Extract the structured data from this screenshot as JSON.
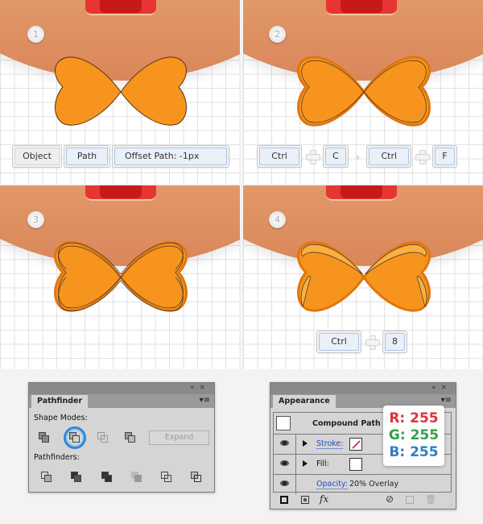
{
  "steps": [
    {
      "number": "1",
      "keys": [
        {
          "label": "Object",
          "style": "grey"
        },
        {
          "label": "Path",
          "style": "blue"
        },
        {
          "label": "Offset Path: -1px",
          "style": "blue"
        }
      ]
    },
    {
      "number": "2",
      "keys": [
        {
          "label": "Ctrl"
        },
        {
          "sep": "plus"
        },
        {
          "label": "C"
        },
        {
          "sep": "chevron"
        },
        {
          "label": "Ctrl"
        },
        {
          "sep": "plus"
        },
        {
          "label": "F"
        }
      ]
    },
    {
      "number": "3"
    },
    {
      "number": "4",
      "keys": [
        {
          "label": "Ctrl"
        },
        {
          "sep": "plus"
        },
        {
          "label": "8"
        }
      ]
    }
  ],
  "colors": {
    "bow_fill": "#f7941d",
    "bow_stroke": "#e2750c",
    "face": "#e9a574",
    "accent_blue": "#2f87d6"
  },
  "pathfinder": {
    "title": "Pathfinder",
    "shape_modes_label": "Shape Modes:",
    "shape_modes": [
      "unite-icon",
      "minus-front-icon",
      "intersect-icon",
      "exclude-icon"
    ],
    "selected_shape_mode": "minus-front-icon",
    "expand_label": "Expand",
    "pathfinders_label": "Pathfinders:",
    "pathfinders": [
      "divide-icon",
      "trim-icon",
      "merge-icon",
      "crop-icon",
      "outline-icon",
      "minus-back-icon"
    ]
  },
  "appearance": {
    "title": "Appearance",
    "object_label": "Compound Path",
    "rows": [
      {
        "label": "Stroke:",
        "swatch": "none"
      },
      {
        "label": "Fill:",
        "swatch": "white"
      },
      {
        "label": "Opacity:",
        "value": "20% Overlay"
      }
    ],
    "fx_label": "fx"
  },
  "rgb": {
    "r": "R: 255",
    "g": "G: 255",
    "b": "B: 255",
    "r_color": "#e0323a",
    "g_color": "#2fa24a",
    "b_color": "#2f7fc1"
  }
}
